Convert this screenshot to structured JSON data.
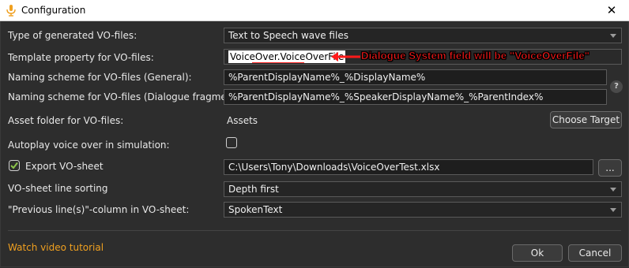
{
  "window": {
    "title": "Configuration",
    "close_glyph": "✕"
  },
  "rows": {
    "vo_type": {
      "label": "Type of generated VO-files:",
      "value": "Text to Speech wave files"
    },
    "template_property": {
      "label": "Template property for VO-files:",
      "value": "VoiceOver.VoiceOverFile"
    },
    "naming_general": {
      "label": "Naming scheme for VO-files (General):",
      "value": "%ParentDisplayName%_%DisplayName%"
    },
    "naming_fragments": {
      "label": "Naming scheme for VO-files (Dialogue fragments):",
      "value": "%ParentDisplayName%_%SpeakerDisplayName%_%ParentIndex%"
    },
    "asset_folder": {
      "label": "Asset folder for VO-files:",
      "value": "Assets",
      "button": "Choose Target"
    },
    "autoplay": {
      "label": "Autoplay voice over in simulation:",
      "checked": false
    },
    "export_sheet": {
      "label": "Export VO-sheet",
      "checked": true,
      "value": "C:\\Users\\Tony\\Downloads\\VoiceOverTest.xlsx",
      "browse": "..."
    },
    "line_sorting": {
      "label": "VO-sheet line sorting",
      "value": "Depth first"
    },
    "previous_lines": {
      "label": "\"Previous line(s)\"-column in VO-sheet:",
      "value": "SpokenText"
    }
  },
  "annotation": {
    "text": "Dialogue System field will be \"VoiceOverFile\"",
    "color": "#ff1a1a"
  },
  "help": {
    "glyph": "?"
  },
  "footer": {
    "link": "Watch video tutorial",
    "ok": "Ok",
    "cancel": "Cancel"
  },
  "colors": {
    "link": "#f0a020",
    "check": "#8bc34a"
  }
}
